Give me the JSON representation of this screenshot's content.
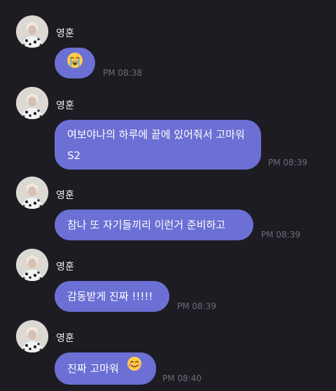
{
  "chat": {
    "messages": [
      {
        "sender": "영훈",
        "text": "",
        "emoji": "loudly-crying-face",
        "time": "PM 08:38"
      },
      {
        "sender": "영훈",
        "text": "여보야나의 하루에 끝에 있어줘서 고마워 S2",
        "time": "PM 08:39"
      },
      {
        "sender": "영훈",
        "text": "참나 또 자기들끼리 이런거 준비하고",
        "time": "PM 08:39"
      },
      {
        "sender": "영훈",
        "text": "감동받게 진짜 !!!!!",
        "time": "PM 08:39"
      },
      {
        "sender": "영훈",
        "text": "진짜 고마워",
        "emoji": "smiling-face-with-smiling-eyes",
        "time": "PM 08:40"
      }
    ]
  },
  "colors": {
    "background": "#1c1c22",
    "bubble": "#6c6fd3",
    "timestamp": "#6c6c78",
    "sender": "#ececf0"
  }
}
